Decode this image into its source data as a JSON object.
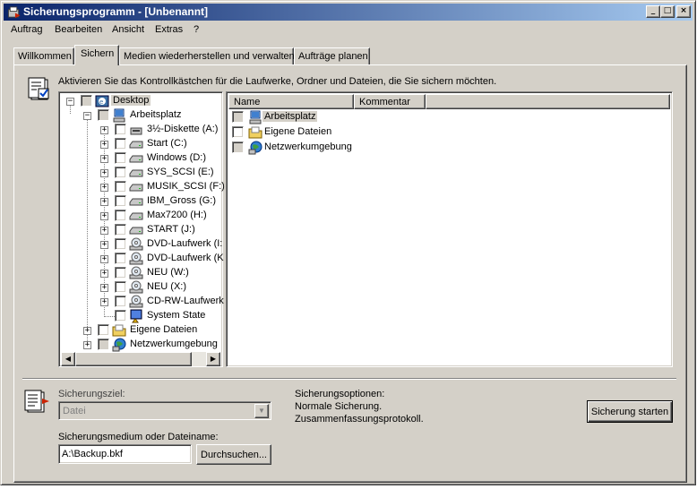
{
  "window": {
    "title": "Sicherungsprogramm - [Unbenannt]",
    "minimize_glyph": "_",
    "maximize_glyph": "□",
    "close_glyph": "×"
  },
  "menu": [
    "Auftrag",
    "Bearbeiten",
    "Ansicht",
    "Extras",
    "?"
  ],
  "tabs": [
    "Willkommen",
    "Sichern",
    "Medien wiederherstellen und verwalten",
    "Aufträge planen"
  ],
  "active_tab": "Sichern",
  "instruction": "Aktivieren Sie das Kontrollkästchen für die Laufwerke, Ordner und Dateien, die Sie sichern möchten.",
  "tree": {
    "root": "Desktop",
    "computer": "Arbeitsplatz",
    "drives": [
      {
        "label": "3½-Diskette (A:)",
        "icon": "floppy-icon"
      },
      {
        "label": "Start (C:)",
        "icon": "drive-icon"
      },
      {
        "label": "Windows (D:)",
        "icon": "drive-icon"
      },
      {
        "label": "SYS_SCSI (E:)",
        "icon": "drive-icon"
      },
      {
        "label": "MUSIK_SCSI (F:)",
        "icon": "drive-icon"
      },
      {
        "label": "IBM_Gross (G:)",
        "icon": "drive-icon"
      },
      {
        "label": "Max7200 (H:)",
        "icon": "drive-icon"
      },
      {
        "label": "START (J:)",
        "icon": "drive-icon"
      },
      {
        "label": "DVD-Laufwerk (I:",
        "icon": "cd-icon"
      },
      {
        "label": "DVD-Laufwerk (K",
        "icon": "cd-icon"
      },
      {
        "label": "NEU (W:)",
        "icon": "cd-icon"
      },
      {
        "label": "NEU (X:)",
        "icon": "cd-icon"
      },
      {
        "label": "CD-RW-Laufwerk",
        "icon": "cd-icon"
      },
      {
        "label": "System State",
        "icon": "system-state-icon"
      }
    ],
    "others": [
      "Eigene Dateien",
      "Netzwerkumgebung"
    ],
    "expand_plus": "+",
    "expand_minus": "−",
    "scroll_left": "◀",
    "scroll_right": "▶"
  },
  "list": {
    "columns": [
      "Name",
      "Kommentar"
    ],
    "items": [
      {
        "label": "Arbeitsplatz",
        "icon": "computer-icon",
        "selected": true
      },
      {
        "label": "Eigene Dateien",
        "icon": "folder-icon",
        "selected": false
      },
      {
        "label": "Netzwerkumgebung",
        "icon": "network-icon",
        "selected": false
      }
    ]
  },
  "bottom": {
    "target_label": "Sicherungsziel:",
    "target_value": "Datei",
    "dropdown_glyph": "▼",
    "media_label": "Sicherungsmedium oder Dateiname:",
    "media_value": "A:\\Backup.bkf",
    "browse_button": "Durchsuchen...",
    "options_title": "Sicherungsoptionen:",
    "options_lines": [
      "Normale Sicherung.",
      "Zusammenfassungsprotokoll."
    ],
    "start_button": "Sicherung starten"
  },
  "colors": {
    "title_start": "#0a246a",
    "title_end": "#a6caf0",
    "face": "#d4d0c8"
  }
}
